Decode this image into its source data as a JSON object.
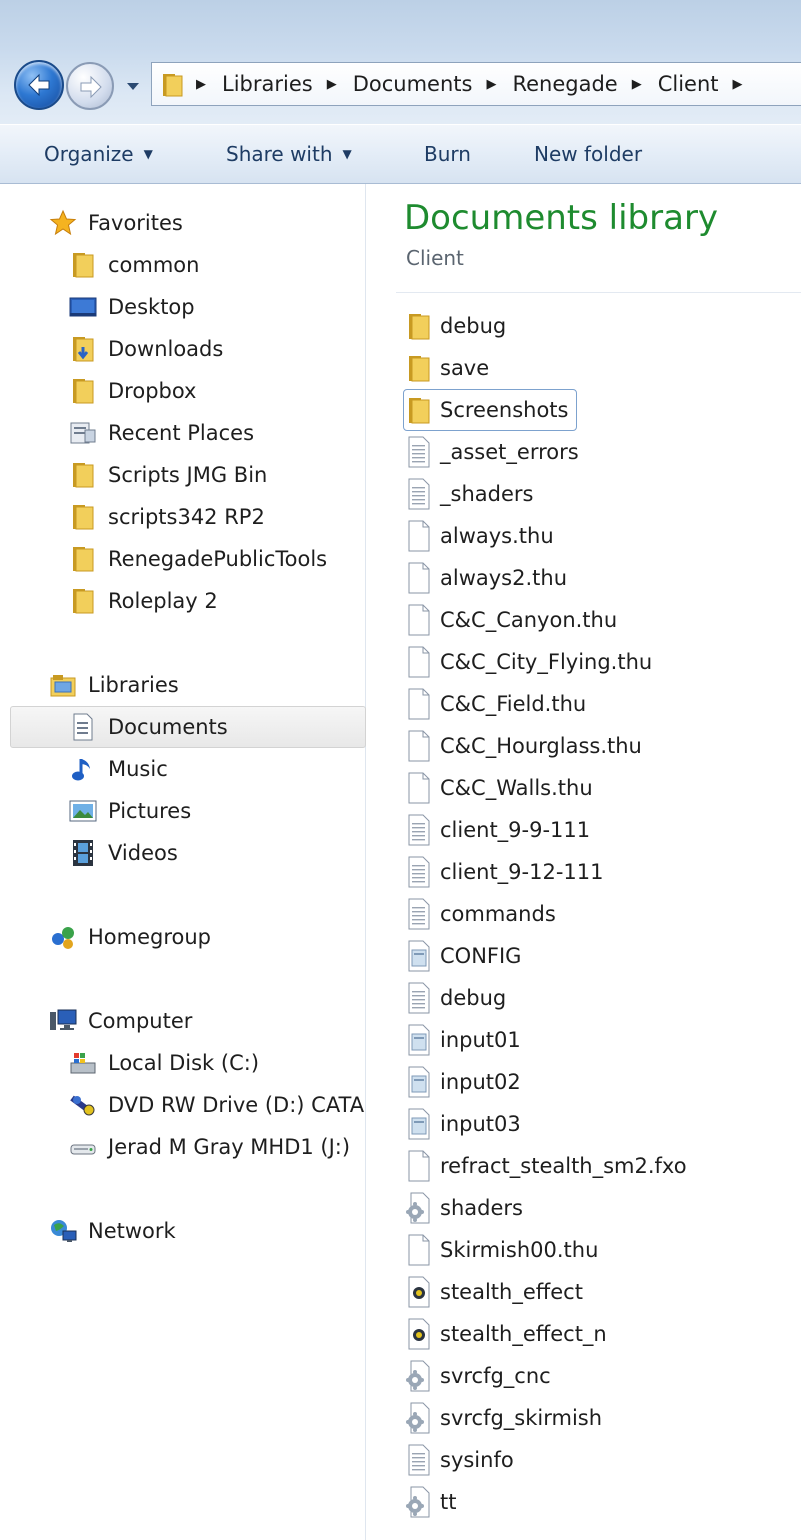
{
  "address": {
    "breadcrumbs": [
      "Libraries",
      "Documents",
      "Renegade",
      "Client"
    ]
  },
  "toolbar": {
    "organize": "Organize",
    "share_with": "Share with",
    "burn": "Burn",
    "new_folder": "New folder"
  },
  "nav": {
    "favorites": {
      "label": "Favorites",
      "items": [
        "common",
        "Desktop",
        "Downloads",
        "Dropbox",
        "Recent Places",
        "Scripts JMG Bin",
        "scripts342 RP2",
        "RenegadePublicTools",
        "Roleplay 2"
      ]
    },
    "libraries": {
      "label": "Libraries",
      "items": [
        "Documents",
        "Music",
        "Pictures",
        "Videos"
      ],
      "selected": "Documents"
    },
    "homegroup": {
      "label": "Homegroup"
    },
    "computer": {
      "label": "Computer",
      "items": [
        "Local Disk (C:)",
        "DVD RW Drive (D:) CATA",
        "Jerad M Gray MHD1 (J:)"
      ]
    },
    "network": {
      "label": "Network"
    }
  },
  "library": {
    "title": "Documents library",
    "subtitle": "Client"
  },
  "files": [
    {
      "name": "debug",
      "icon": "folder-icon"
    },
    {
      "name": "save",
      "icon": "folder-icon"
    },
    {
      "name": "Screenshots",
      "icon": "folder-icon"
    },
    {
      "name": "_asset_errors",
      "icon": "text-file-icon"
    },
    {
      "name": "_shaders",
      "icon": "text-file-icon"
    },
    {
      "name": "always.thu",
      "icon": "blank-file-icon"
    },
    {
      "name": "always2.thu",
      "icon": "blank-file-icon"
    },
    {
      "name": "C&C_Canyon.thu",
      "icon": "blank-file-icon"
    },
    {
      "name": "C&C_City_Flying.thu",
      "icon": "blank-file-icon"
    },
    {
      "name": "C&C_Field.thu",
      "icon": "blank-file-icon"
    },
    {
      "name": "C&C_Hourglass.thu",
      "icon": "blank-file-icon"
    },
    {
      "name": "C&C_Walls.thu",
      "icon": "blank-file-icon"
    },
    {
      "name": "client_9-9-111",
      "icon": "text-file-icon"
    },
    {
      "name": "client_9-12-111",
      "icon": "text-file-icon"
    },
    {
      "name": "commands",
      "icon": "text-file-icon"
    },
    {
      "name": "CONFIG",
      "icon": "config-file-icon"
    },
    {
      "name": "debug",
      "icon": "text-file-icon"
    },
    {
      "name": "input01",
      "icon": "config-file-icon"
    },
    {
      "name": "input02",
      "icon": "config-file-icon"
    },
    {
      "name": "input03",
      "icon": "config-file-icon"
    },
    {
      "name": "refract_stealth_sm2.fxo",
      "icon": "blank-file-icon"
    },
    {
      "name": "shaders",
      "icon": "settings-file-icon"
    },
    {
      "name": "Skirmish00.thu",
      "icon": "blank-file-icon"
    },
    {
      "name": "stealth_effect",
      "icon": "shader-file-icon"
    },
    {
      "name": "stealth_effect_n",
      "icon": "shader-file-icon"
    },
    {
      "name": "svrcfg_cnc",
      "icon": "settings-file-icon"
    },
    {
      "name": "svrcfg_skirmish",
      "icon": "settings-file-icon"
    },
    {
      "name": "sysinfo",
      "icon": "text-file-icon"
    },
    {
      "name": "tt",
      "icon": "settings-file-icon"
    }
  ],
  "focused_file": "Screenshots"
}
